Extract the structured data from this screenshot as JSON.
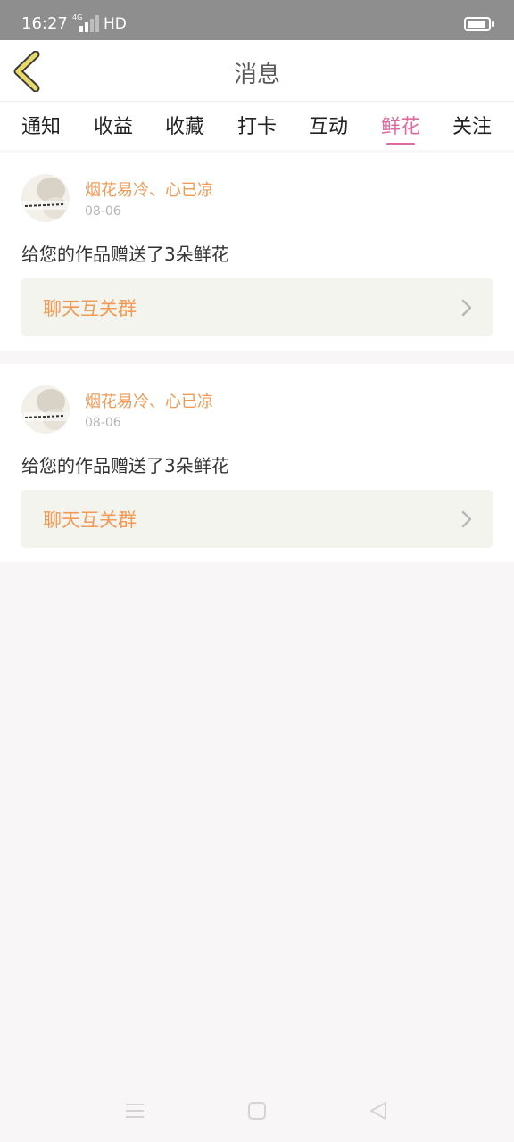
{
  "status_bar": {
    "time": "16:27",
    "network": "4G",
    "hd": "HD",
    "signal_icon": "signal-icon",
    "battery_icon": "battery-icon"
  },
  "header": {
    "title": "消息",
    "back_icon": "chevron-left-icon"
  },
  "tabs": [
    {
      "label": "通知",
      "active": false
    },
    {
      "label": "收益",
      "active": false
    },
    {
      "label": "收藏",
      "active": false
    },
    {
      "label": "打卡",
      "active": false
    },
    {
      "label": "互动",
      "active": false
    },
    {
      "label": "鲜花",
      "active": true
    },
    {
      "label": "关注",
      "active": false
    }
  ],
  "messages": [
    {
      "sender": "烟花易冷、心已凉",
      "date": "08-06",
      "text": "给您的作品赠送了3朵鲜花",
      "action_label": "聊天互关群"
    },
    {
      "sender": "烟花易冷、心已凉",
      "date": "08-06",
      "text": "给您的作品赠送了3朵鲜花",
      "action_label": "聊天互关群"
    }
  ],
  "nav_bar": {
    "menu_icon": "menu-icon",
    "home_icon": "home-icon",
    "back_icon": "back-triangle-icon"
  },
  "colors": {
    "accent": "#e06aa0",
    "sender": "#f09a55",
    "back_arrow": "#e8d96a",
    "status_bar": "#8e8e8e"
  }
}
